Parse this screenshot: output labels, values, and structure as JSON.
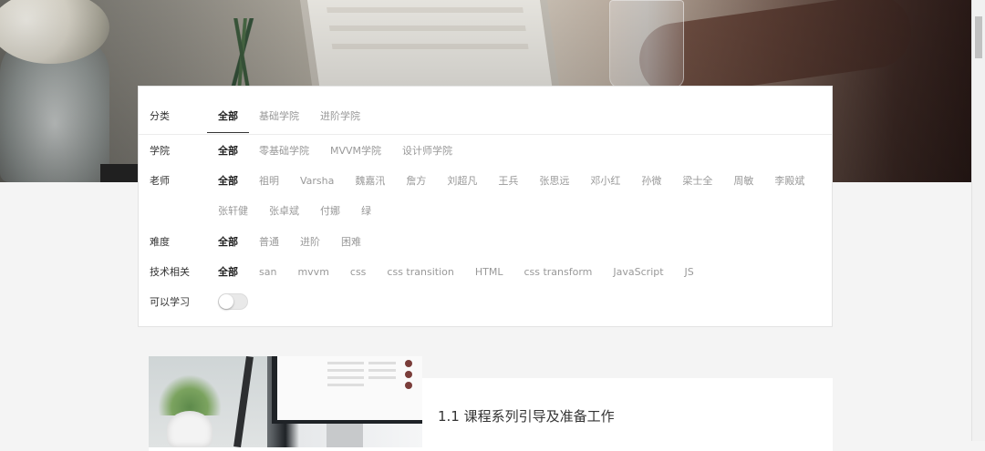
{
  "filters": {
    "category": {
      "label": "分类",
      "options": [
        "全部",
        "基础学院",
        "进阶学院"
      ]
    },
    "academy": {
      "label": "学院",
      "options": [
        "全部",
        "零基础学院",
        "MVVM学院",
        "设计师学院"
      ]
    },
    "teacher": {
      "label": "老师",
      "options": [
        "全部",
        "祖明",
        "Varsha",
        "魏嘉汛",
        "詹方",
        "刘超凡",
        "王兵",
        "张思远",
        "邓小红",
        "孙微",
        "梁士全",
        "周敏",
        "李殿斌",
        "张轩健",
        "张卓斌",
        "付娜",
        "绿"
      ]
    },
    "difficulty": {
      "label": "难度",
      "options": [
        "全部",
        "普通",
        "进阶",
        "困难"
      ]
    },
    "tech": {
      "label": "技术相关",
      "options": [
        "全部",
        "san",
        "mvvm",
        "css",
        "css transition",
        "HTML",
        "css transform",
        "JavaScript",
        "JS"
      ]
    },
    "learnable": {
      "label": "可以学习",
      "enabled": false
    }
  },
  "course": {
    "title": "1.1 课程系列引导及准备工作"
  },
  "colors": {
    "page_bg": "#f4f4f4",
    "active_text": "#222222",
    "inactive_text": "#999999",
    "panel_bg": "#ffffff"
  },
  "icons": [
    "toggle-switch"
  ]
}
